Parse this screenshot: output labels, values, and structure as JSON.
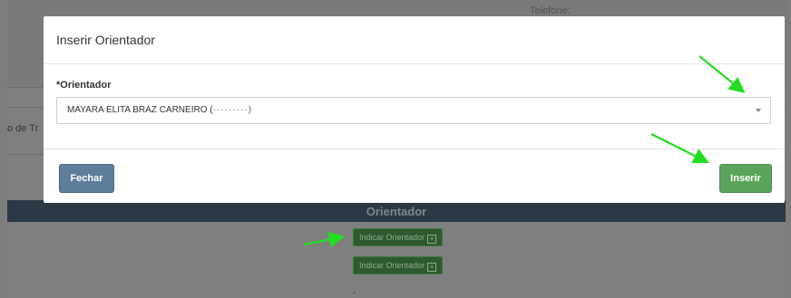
{
  "background": {
    "phone_label": "Telefone:",
    "left_cut_label": "o de Tr",
    "section_title": "Orientador",
    "indicate_buttons": [
      {
        "label": "Indicar Orientador",
        "icon": "plus-square-icon"
      },
      {
        "label": "Indicar Orientador",
        "icon": "plus-square-icon"
      }
    ],
    "dash": "-"
  },
  "modal": {
    "title": "Inserir Orientador",
    "field_label": "*Orientador",
    "select_value": "MAYARA ELITA BRAZ CARNEIRO (",
    "select_masked": "·········)",
    "close_label": "Fechar",
    "insert_label": "Inserir"
  },
  "colors": {
    "insert_button": "#5aa35a",
    "close_button": "#5d7d9a",
    "annotation_arrow": "#22dd22"
  }
}
